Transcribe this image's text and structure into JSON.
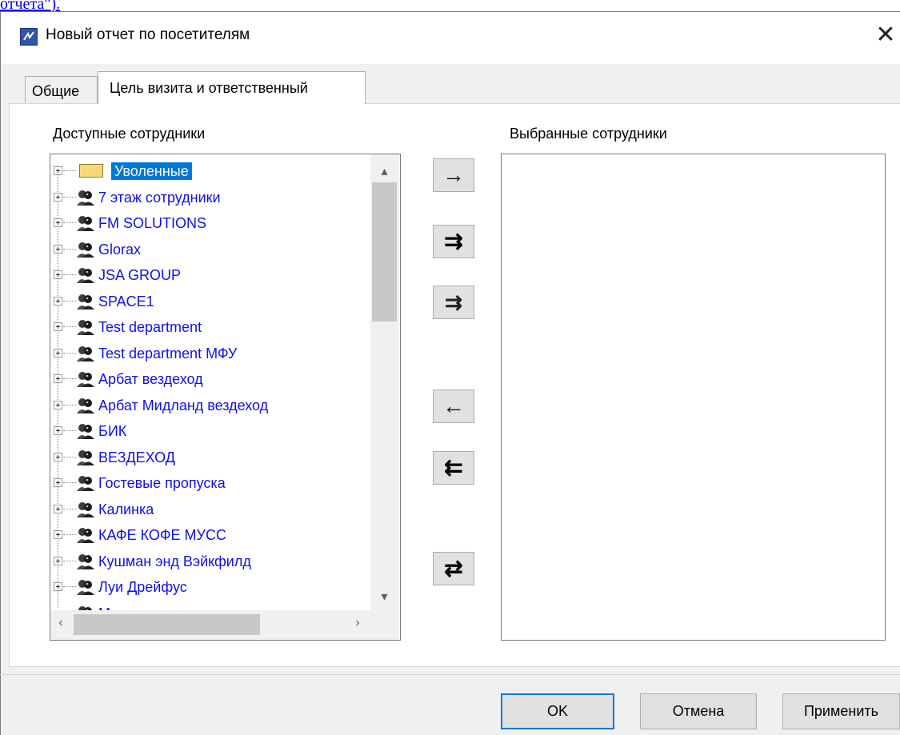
{
  "background": {
    "link_fragment": "отчета\")."
  },
  "window": {
    "title": "Новый отчет по посетителям",
    "close_glyph": "✕"
  },
  "tabs": [
    {
      "label": "Общие",
      "active": false
    },
    {
      "label": "Цель визита и ответственный",
      "active": true
    }
  ],
  "available": {
    "label": "Доступные сотрудники",
    "items": [
      {
        "label": "Уволенные",
        "icon": "folder-icon",
        "selected": true
      },
      {
        "label": "7 этаж сотрудники",
        "icon": "people-group-icon"
      },
      {
        "label": "FM SOLUTIONS",
        "icon": "people-group-icon"
      },
      {
        "label": "Glorax",
        "icon": "people-group-icon"
      },
      {
        "label": "JSA GROUP",
        "icon": "people-group-icon"
      },
      {
        "label": "SPACE1",
        "icon": "people-group-icon"
      },
      {
        "label": "Test department",
        "icon": "people-group-icon"
      },
      {
        "label": "Test department МФУ",
        "icon": "people-group-icon"
      },
      {
        "label": "Арбат вездеход",
        "icon": "people-group-icon"
      },
      {
        "label": "Арбат Мидланд вездеход",
        "icon": "people-group-icon"
      },
      {
        "label": "БИК",
        "icon": "people-group-icon"
      },
      {
        "label": "ВЕЗДЕХОД",
        "icon": "people-group-icon"
      },
      {
        "label": "Гостевые пропуска",
        "icon": "people-group-icon"
      },
      {
        "label": "Калинка",
        "icon": "people-group-icon"
      },
      {
        "label": "КАФЕ КОФЕ МУСС",
        "icon": "people-group-icon"
      },
      {
        "label": "Кушман энд Вэйкфилд",
        "icon": "people-group-icon"
      },
      {
        "label": "Луи Дрейфус",
        "icon": "people-group-icon"
      },
      {
        "label": "Маммут",
        "icon": "people-group-icon"
      }
    ]
  },
  "transfer_buttons": {
    "add_one": "→",
    "add_all": "⇉",
    "add_dotted": "⇉",
    "remove_one": "←",
    "remove_all": "⇇",
    "swap": "⇄"
  },
  "selected": {
    "label": "Выбранные сотрудники",
    "items": []
  },
  "footer": {
    "ok": "OK",
    "cancel": "Отмена",
    "apply": "Применить"
  },
  "colors": {
    "accent": "#0078d7",
    "tree_text": "#1010e6",
    "dialog_bg": "#f0f0f0"
  }
}
